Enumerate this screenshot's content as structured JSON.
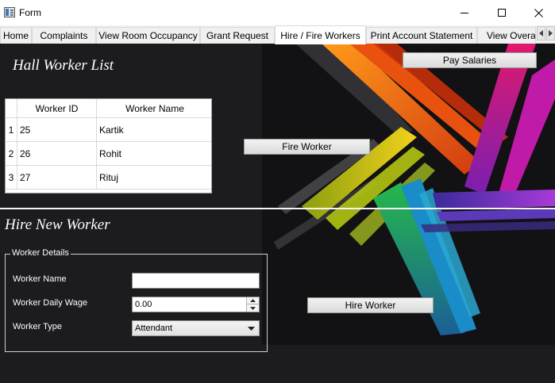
{
  "window": {
    "title": "Form",
    "icon": "form-window-icon",
    "controls": [
      "minimize-icon",
      "maximize-icon",
      "close-icon"
    ]
  },
  "tabs": [
    {
      "label": "Home"
    },
    {
      "label": "Complaints"
    },
    {
      "label": "View Room Occupancy"
    },
    {
      "label": "Grant Request"
    },
    {
      "label": "Hire / Fire Workers"
    },
    {
      "label": "Print Account Statement"
    },
    {
      "label": "View Overall"
    }
  ],
  "active_tab": "Hire / Fire Workers",
  "tab_scroll_icon": "chevron-left-icon",
  "hall_worker_list": {
    "heading": "Hall Worker List",
    "columns": [
      "Worker ID",
      "Worker Name"
    ],
    "rows": [
      {
        "num": "1",
        "id": "25",
        "name": "Kartik"
      },
      {
        "num": "2",
        "id": "26",
        "name": "Rohit"
      },
      {
        "num": "3",
        "id": "27",
        "name": "Rituj"
      }
    ]
  },
  "buttons": {
    "pay_salaries": "Pay Salaries",
    "fire_worker": "Fire Worker",
    "hire_worker": "Hire Worker"
  },
  "hire_new_worker": {
    "heading": "Hire New Worker",
    "group_title": "Worker Details",
    "name_label": "Worker Name",
    "name_value": "",
    "wage_label": "Worker Daily Wage",
    "wage_value": "0.00",
    "type_label": "Worker Type",
    "type_value": "Attendant"
  },
  "colors": {
    "content_bg": "#1c1b1d",
    "text_on_dark": "#ffffff"
  }
}
